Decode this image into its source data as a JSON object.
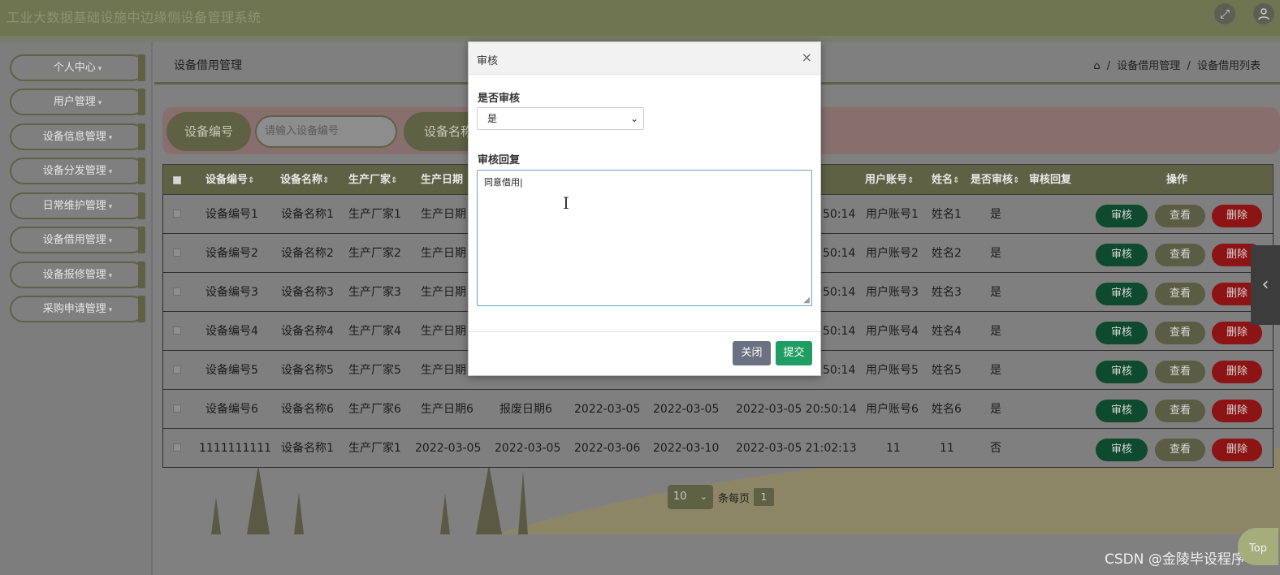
{
  "header": {
    "title": "工业大数据基础设施中边缘侧设备管理系统",
    "icons": [
      "fullscreen-icon",
      "user-icon"
    ]
  },
  "sidebar": {
    "items": [
      {
        "label": "个人中心"
      },
      {
        "label": "用户管理"
      },
      {
        "label": "设备信息管理"
      },
      {
        "label": "设备分发管理"
      },
      {
        "label": "日常维护管理"
      },
      {
        "label": "设备借用管理"
      },
      {
        "label": "设备报修管理"
      },
      {
        "label": "采购申请管理"
      }
    ],
    "caret": "▾"
  },
  "page": {
    "title": "设备借用管理",
    "breadcrumb": [
      "设备借用管理",
      "设备借用列表"
    ],
    "breadcrumb_sep": "/"
  },
  "search": {
    "label1": "设备编号",
    "placeholder1": "请输入设备编号",
    "label2": "设备名称"
  },
  "table": {
    "headers": [
      {
        "text": "设备编号",
        "sortable": true
      },
      {
        "text": "设备名称",
        "sortable": true
      },
      {
        "text": "生产厂家",
        "sortable": true
      },
      {
        "text": "生产日期",
        "sortable": false
      },
      {
        "text": "用户账号",
        "sortable": true
      },
      {
        "text": "姓名",
        "sortable": true
      },
      {
        "text": "是否审核",
        "sortable": true
      },
      {
        "text": "审核回复",
        "sortable": false
      },
      {
        "text": "操作",
        "sortable": false
      }
    ],
    "sort_icon": "⇕",
    "rows": [
      {
        "code": "设备编号1",
        "name": "设备名称1",
        "maker": "生产厂家1",
        "prod": "生产日期",
        "scrap": "",
        "d1": "",
        "d2": "",
        "time": "50:14",
        "account": "用户账号1",
        "person": "姓名1",
        "audited": "是"
      },
      {
        "code": "设备编号2",
        "name": "设备名称2",
        "maker": "生产厂家2",
        "prod": "生产日期",
        "scrap": "",
        "d1": "",
        "d2": "",
        "time": "50:14",
        "account": "用户账号2",
        "person": "姓名2",
        "audited": "是"
      },
      {
        "code": "设备编号3",
        "name": "设备名称3",
        "maker": "生产厂家3",
        "prod": "生产日期",
        "scrap": "",
        "d1": "",
        "d2": "",
        "time": "50:14",
        "account": "用户账号3",
        "person": "姓名3",
        "audited": "是"
      },
      {
        "code": "设备编号4",
        "name": "设备名称4",
        "maker": "生产厂家4",
        "prod": "生产日期",
        "scrap": "",
        "d1": "",
        "d2": "",
        "time": "50:14",
        "account": "用户账号4",
        "person": "姓名4",
        "audited": "是"
      },
      {
        "code": "设备编号5",
        "name": "设备名称5",
        "maker": "生产厂家5",
        "prod": "生产日期",
        "scrap": "",
        "d1": "",
        "d2": "",
        "time": "50:14",
        "account": "用户账号5",
        "person": "姓名5",
        "audited": "是"
      },
      {
        "code": "设备编号6",
        "name": "设备名称6",
        "maker": "生产厂家6",
        "prod": "生产日期6",
        "scrap": "报废日期6",
        "d1": "2022-03-05",
        "d2": "2022-03-05",
        "time": "2022-03-05 20:50:14",
        "account": "用户账号6",
        "person": "姓名6",
        "audited": "是"
      },
      {
        "code": "1111111111",
        "name": "设备名称1",
        "maker": "生产厂家1",
        "prod": "2022-03-05",
        "scrap": "2022-03-05",
        "d1": "2022-03-06",
        "d2": "2022-03-10",
        "time": "2022-03-05 21:02:13",
        "account": "11",
        "person": "11",
        "audited": "否"
      }
    ],
    "actions": {
      "audit": "审核",
      "view": "查看",
      "delete": "删除"
    }
  },
  "pager": {
    "page_size": "10",
    "per_page_label": "条每页",
    "current_page": "1"
  },
  "modal": {
    "title": "审核",
    "close_glyph": "×",
    "audit_label": "是否审核",
    "audit_value": "是",
    "reply_label": "审核回复",
    "reply_value": "同意借用",
    "btn_close": "关闭",
    "btn_submit": "提交"
  },
  "watermark": "CSDN @金陵毕设程序",
  "top_badge": "Top",
  "colors": {
    "accent": "#5e6144",
    "audit_button": "#0e4a2e",
    "delete_button": "#8c1414",
    "submit_button": "#1f9d62",
    "close_button": "#6a7282"
  }
}
